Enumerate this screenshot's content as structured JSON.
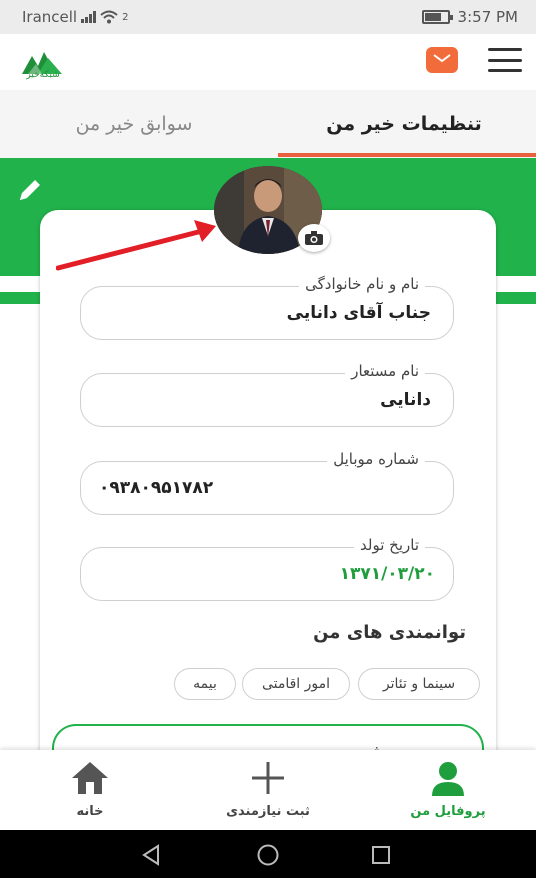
{
  "status_bar": {
    "carrier": "Irancell",
    "signal_glyph": "2",
    "time": "3:57 PM"
  },
  "app_header": {
    "logo_text": "شبکه‌خیر",
    "logo_color": "#1f8f3a",
    "mail_color": "#f26b3a"
  },
  "tabs": [
    {
      "label": "تنظیمات خیر من",
      "active": true
    },
    {
      "label": "سوابق خیر من",
      "active": false
    }
  ],
  "accent_color": "#21b24b",
  "tab_underline_color": "#e8603c",
  "profile": {
    "fields": [
      {
        "label": "نام و نام خانوادگی",
        "value": "جناب آقای دانایی"
      },
      {
        "label": "نام مستعار",
        "value": "دانایی"
      },
      {
        "label": "شماره موبایل",
        "value": "۰۹۳۸۰۹۵۱۷۸۲"
      },
      {
        "label": "تاریخ تولد",
        "value": "۱۳۷۱/۰۳/۲۰"
      }
    ],
    "abilities_title": "توانمندی های من",
    "chips": [
      "سینما و تئاتر",
      "امور اقامتی",
      "بیمه"
    ],
    "partial_glyph": "ش"
  },
  "bottom_nav": [
    {
      "label": "پروفایل من",
      "icon": "person-icon",
      "active": true
    },
    {
      "label": "ثبت نیازمندی",
      "icon": "plus-icon",
      "active": false
    },
    {
      "label": "خانه",
      "icon": "home-icon",
      "active": false
    }
  ]
}
